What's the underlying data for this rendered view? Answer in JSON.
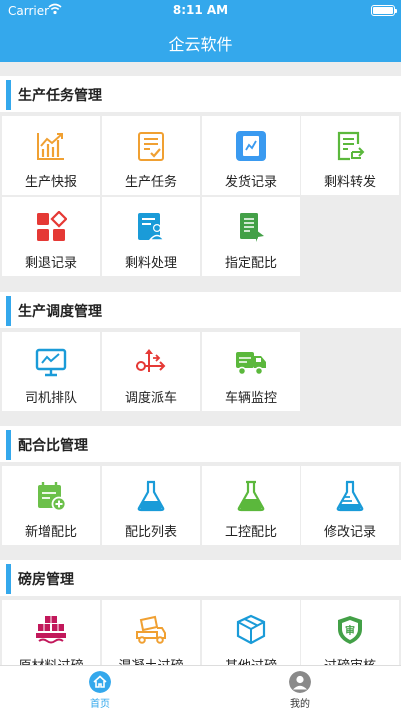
{
  "status_bar": {
    "carrier": "Carrier",
    "time": "8:11 AM"
  },
  "app_title": "企云软件",
  "colors": {
    "header": "#34a8ec",
    "accent": "#34a8ec"
  },
  "sections": [
    {
      "title": "生产任务管理",
      "tiles": [
        {
          "label": "生产快报",
          "icon": "line-chart-icon"
        },
        {
          "label": "生产任务",
          "icon": "task-checklist-icon"
        },
        {
          "label": "发货记录",
          "icon": "shipping-record-icon"
        },
        {
          "label": "剩料转发",
          "icon": "document-forward-icon"
        },
        {
          "label": "剩退记录",
          "icon": "grid-diamond-icon"
        },
        {
          "label": "剩料处理",
          "icon": "document-person-icon"
        },
        {
          "label": "指定配比",
          "icon": "document-flag-icon"
        }
      ]
    },
    {
      "title": "生产调度管理",
      "tiles": [
        {
          "label": "司机排队",
          "icon": "monitor-icon"
        },
        {
          "label": "调度派车",
          "icon": "dispatch-arrows-icon"
        },
        {
          "label": "车辆监控",
          "icon": "truck-icon"
        }
      ]
    },
    {
      "title": "配合比管理",
      "tiles": [
        {
          "label": "新增配比",
          "icon": "calendar-add-icon"
        },
        {
          "label": "配比列表",
          "icon": "flask-icon"
        },
        {
          "label": "工控配比",
          "icon": "beaker-icon"
        },
        {
          "label": "修改记录",
          "icon": "flask-edit-icon"
        }
      ]
    },
    {
      "title": "磅房管理",
      "tiles": [
        {
          "label": "原材料过磅",
          "icon": "materials-scale-icon"
        },
        {
          "label": "混凝土过磅",
          "icon": "concrete-truck-icon"
        },
        {
          "label": "其他过磅",
          "icon": "package-icon"
        },
        {
          "label": "过磅审核",
          "icon": "audit-shield-icon"
        }
      ]
    }
  ],
  "tabbar": [
    {
      "label": "首页",
      "icon": "home-icon",
      "active": true
    },
    {
      "label": "我的",
      "icon": "user-avatar-icon",
      "active": false
    }
  ]
}
